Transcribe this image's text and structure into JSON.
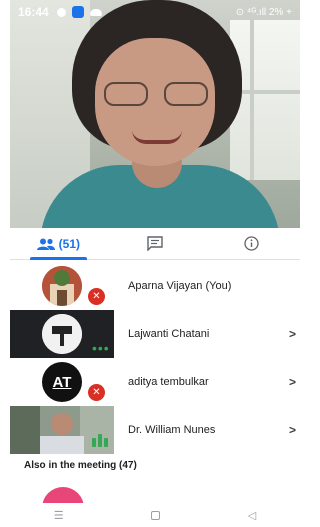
{
  "status_bar": {
    "time": "16:44",
    "right_text": "⊙ ⁴ᴳ.ıll 2% +"
  },
  "tabs": [
    {
      "label": "(51)",
      "icon": "people-icon",
      "active": true
    },
    {
      "label": "",
      "icon": "chat-icon",
      "active": false
    },
    {
      "label": "",
      "icon": "info-icon",
      "active": false
    }
  ],
  "participants": [
    {
      "name": "Aparna Vijayan (You)",
      "muted": true,
      "chevron": ""
    },
    {
      "name": "Lajwanti Chatani",
      "muted": false,
      "chevron": ">"
    },
    {
      "name": "aditya tembulkar",
      "muted": true,
      "chevron": ">",
      "avatar_text": "AT"
    },
    {
      "name": "Dr. William Nunes",
      "muted": false,
      "chevron": ">"
    }
  ],
  "also_in_meeting": "Also in the meeting (47)",
  "colors": {
    "accent": "#1a73e8",
    "mute_red": "#d93025",
    "speaking_green": "#34a853"
  }
}
